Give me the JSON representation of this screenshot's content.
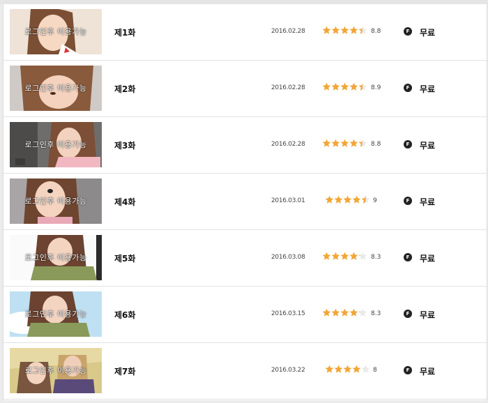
{
  "thumb_overlay": "로그인후 이용가능",
  "star_color": "#f2a637",
  "star_empty_color": "#e9e9e9",
  "coin_icon": "F",
  "episodes": [
    {
      "title": "제1화",
      "date": "2016.02.28",
      "rating": 8.8,
      "rating_label": "8.8",
      "price": "무료"
    },
    {
      "title": "제2화",
      "date": "2016.02.28",
      "rating": 8.9,
      "rating_label": "8.9",
      "price": "무료"
    },
    {
      "title": "제3화",
      "date": "2016.02.28",
      "rating": 8.8,
      "rating_label": "8.8",
      "price": "무료"
    },
    {
      "title": "제4화",
      "date": "2016.03.01",
      "rating": 9,
      "rating_label": "9",
      "price": "무료"
    },
    {
      "title": "제5화",
      "date": "2016.03.08",
      "rating": 8.3,
      "rating_label": "8.3",
      "price": "무료"
    },
    {
      "title": "제6화",
      "date": "2016.03.15",
      "rating": 8.3,
      "rating_label": "8.3",
      "price": "무료"
    },
    {
      "title": "제7화",
      "date": "2016.03.22",
      "rating": 8,
      "rating_label": "8",
      "price": "무료"
    }
  ]
}
